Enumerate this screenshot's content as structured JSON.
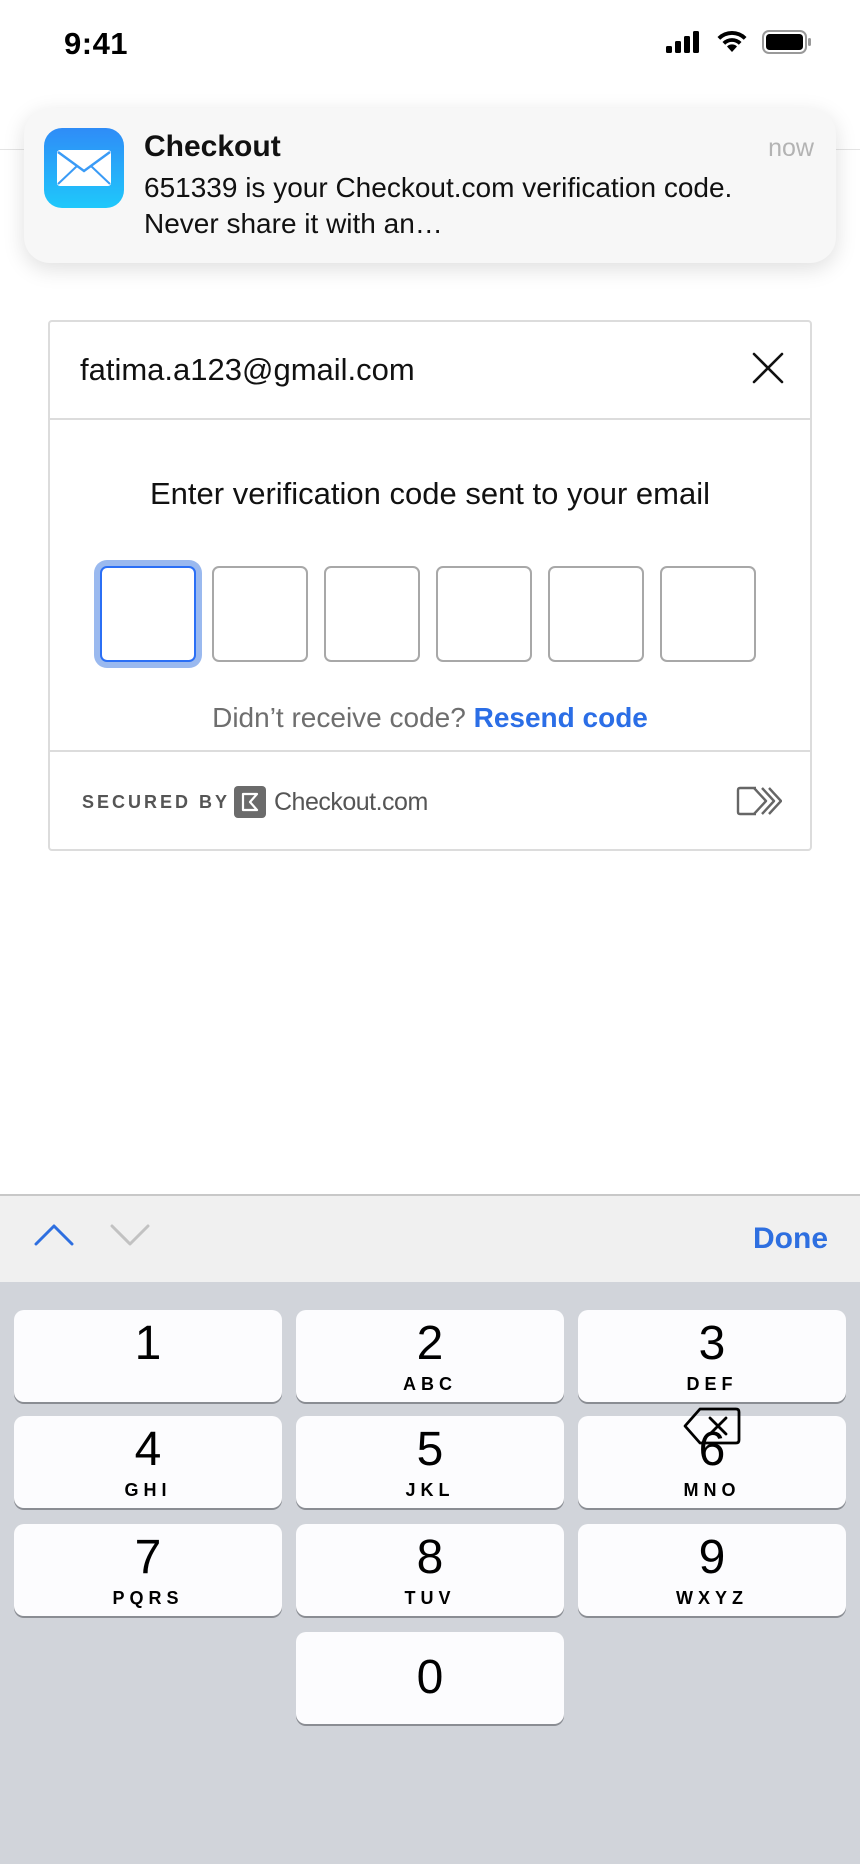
{
  "status_bar": {
    "time": "9:41",
    "icons": [
      "signal-icon",
      "wifi-icon",
      "battery-icon"
    ]
  },
  "notification": {
    "app_name": "Checkout",
    "time": "now",
    "body": "651339 is your Checkout.com verification code. Never share it with an…",
    "icon": "mail-icon"
  },
  "card": {
    "email": "fatima.a123@gmail.com",
    "title": "Enter verification code sent to your email",
    "code_boxes": [
      "",
      "",
      "",
      "",
      "",
      ""
    ],
    "resend_prompt": "Didn’t receive code?",
    "resend_link": "Resend code",
    "secured_by": "SECURED BY",
    "provider_name": "Checkout.com"
  },
  "keyboard": {
    "done_label": "Done",
    "keys": [
      {
        "digit": "1",
        "letters": ""
      },
      {
        "digit": "2",
        "letters": "ABC"
      },
      {
        "digit": "3",
        "letters": "DEF"
      },
      {
        "digit": "4",
        "letters": "GHI"
      },
      {
        "digit": "5",
        "letters": "JKL"
      },
      {
        "digit": "6",
        "letters": "MNO"
      },
      {
        "digit": "7",
        "letters": "PQRS"
      },
      {
        "digit": "8",
        "letters": "TUV"
      },
      {
        "digit": "9",
        "letters": "WXYZ"
      },
      {
        "digit": "0",
        "letters": ""
      }
    ]
  },
  "colors": {
    "accent": "#2b6ee6",
    "focus_ring": "#9ab9ef",
    "keypad_bg": "#d1d4da"
  }
}
